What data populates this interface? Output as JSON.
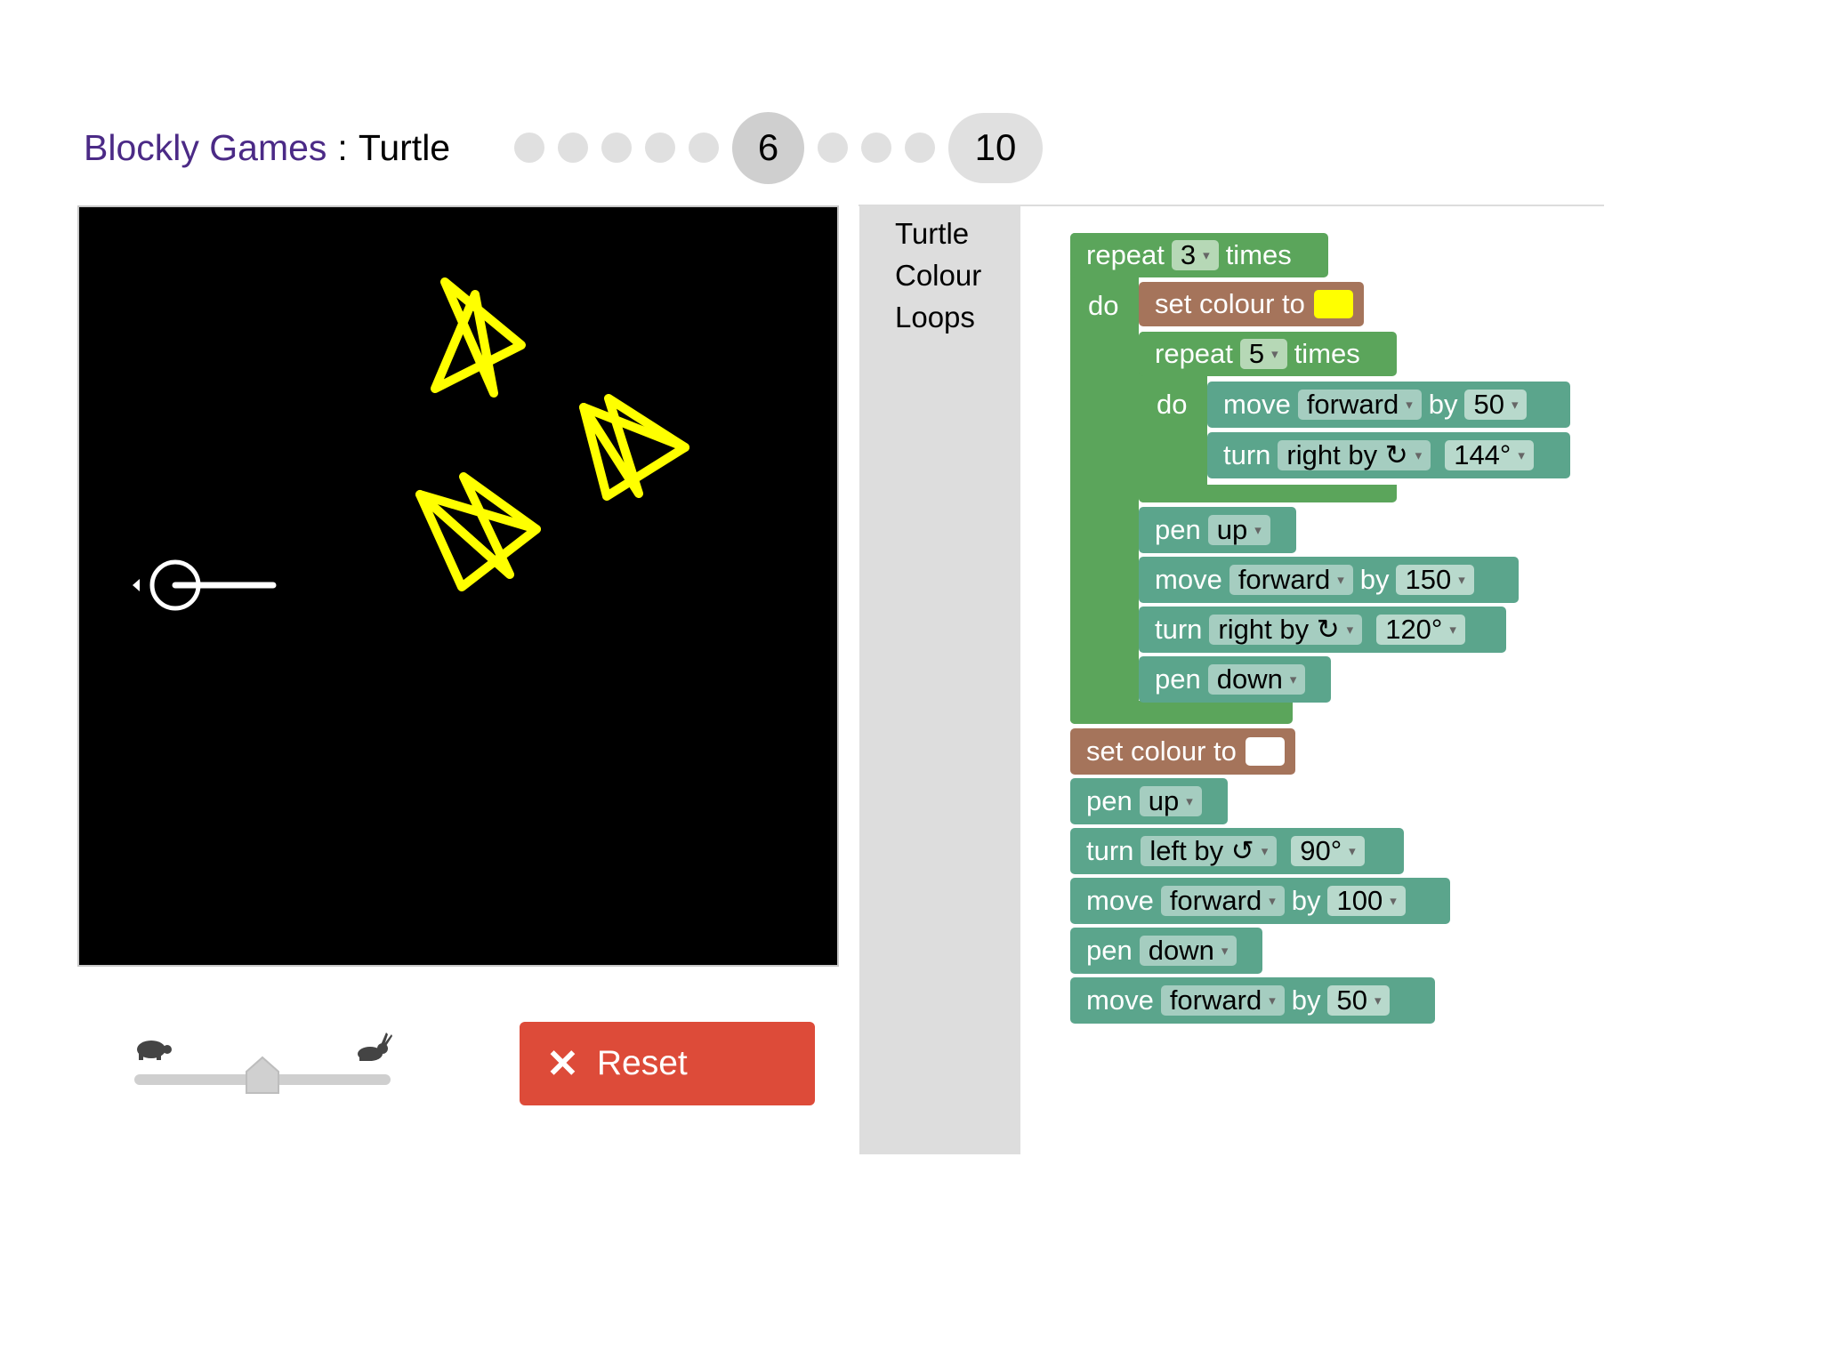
{
  "header": {
    "app_name": "Blockly Games",
    "separator": ":",
    "game_name": "Turtle",
    "levels": {
      "current_label": "6",
      "last_label": "10"
    }
  },
  "toolbox": {
    "categories": [
      "Turtle",
      "Colour",
      "Loops"
    ]
  },
  "controls": {
    "reset_label": "Reset"
  },
  "colors": {
    "loop_block": "#5ba55b",
    "turtle_block": "#5ba58c",
    "colour_block": "#a5745b",
    "reset_button": "#dd4b39",
    "star_colour": "#ffff00",
    "pen_colour_swatch_1": "#ffff00",
    "pen_colour_swatch_2": "#ffffff",
    "title_colour": "#4b2a86"
  },
  "icons": [
    "turtle-slow-icon",
    "rabbit-fast-icon",
    "close-x-icon",
    "turtle-cursor-icon",
    "dropdown-arrow-icon"
  ],
  "speed": {
    "value": 0.5
  },
  "program": {
    "outer_repeat": {
      "label": "repeat",
      "count": "3",
      "suffix": "times",
      "do": "do",
      "set_colour": "set colour to",
      "inner_repeat": {
        "label": "repeat",
        "count": "5",
        "suffix": "times",
        "do": "do",
        "move": {
          "label": "move",
          "direction": "forward",
          "by": "by",
          "amount": "50"
        },
        "turn": {
          "label": "turn",
          "direction": "right by ↻",
          "angle": "144°"
        }
      },
      "pen_up": {
        "label": "pen",
        "state": "up"
      },
      "move": {
        "label": "move",
        "direction": "forward",
        "by": "by",
        "amount": "150"
      },
      "turn": {
        "label": "turn",
        "direction": "right by ↻",
        "angle": "120°"
      },
      "pen_down": {
        "label": "pen",
        "state": "down"
      }
    },
    "after": {
      "set_colour": "set colour to",
      "pen_up": {
        "label": "pen",
        "state": "up"
      },
      "turn": {
        "label": "turn",
        "direction": "left by ↺",
        "angle": "90°"
      },
      "move1": {
        "label": "move",
        "direction": "forward",
        "by": "by",
        "amount": "100"
      },
      "pen_down": {
        "label": "pen",
        "state": "down"
      },
      "move2": {
        "label": "move",
        "direction": "forward",
        "by": "by",
        "amount": "50"
      }
    }
  }
}
